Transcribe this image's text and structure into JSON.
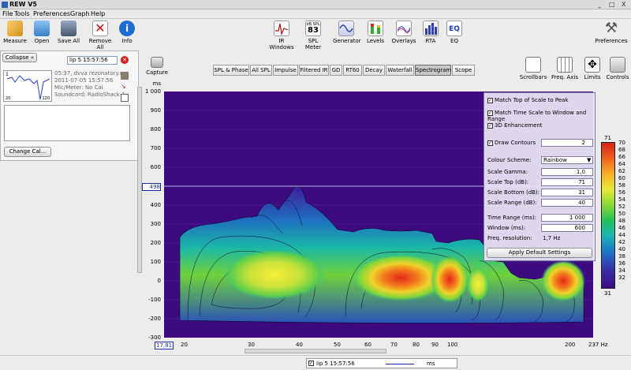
{
  "window": {
    "title": "REW V5",
    "controls": [
      "_",
      "□",
      "X"
    ]
  },
  "menu": [
    "File",
    "Tools",
    "Preferences",
    "Graph",
    "Help"
  ],
  "toolbar_left": [
    {
      "label": "Measure",
      "icon": "measure-icon"
    },
    {
      "label": "Open",
      "icon": "folder-icon"
    },
    {
      "label": "Save All",
      "icon": "save-icon"
    },
    {
      "label": "Remove All",
      "icon": "remove-icon"
    },
    {
      "label": "Info",
      "icon": "info-icon"
    }
  ],
  "toolbar_center": [
    {
      "label": "IR Windows",
      "icon": "ir-windows-icon"
    },
    {
      "label": "SPL Meter",
      "icon": "spl-meter-icon",
      "badge_top": "dB SPL",
      "badge_value": "83"
    },
    {
      "label": "Generator",
      "icon": "generator-icon"
    },
    {
      "label": "Levels",
      "icon": "levels-icon"
    },
    {
      "label": "Overlays",
      "icon": "overlays-icon"
    },
    {
      "label": "RTA",
      "icon": "rta-icon"
    },
    {
      "label": "EQ",
      "icon": "eq-icon"
    }
  ],
  "preferences_label": "Preferences",
  "left_panel": {
    "collapse_label": "Collapse",
    "measurement_name": "lip 5 15:57:56",
    "thumb_labels": [
      "1",
      "20",
      "120"
    ],
    "info_lines": [
      "05:37, dvva rezonatory.mo",
      "2011-07-05 15:57:56",
      "Mic/Meter: No Cal",
      "Soundcard: RadioShack-1"
    ],
    "change_cal_label": "Change Cal..."
  },
  "capture_label": "Capture",
  "tabs": [
    "SPL & Phase",
    "All SPL",
    "Impulse",
    "Filtered IR",
    "GD",
    "RT60",
    "Decay",
    "Waterfall",
    "Spectrogram",
    "Scope"
  ],
  "active_tab": "Spectrogram",
  "right_tools": [
    "Scrollbars",
    "Freq. Axis",
    "Limits",
    "Controls"
  ],
  "y_axis": {
    "unit": "ms",
    "ticks": [
      "1 000",
      "900",
      "800",
      "700",
      "600",
      "500",
      "400",
      "300",
      "200",
      "100",
      "0",
      "-100",
      "-200",
      "-300"
    ],
    "marker": "498",
    "corner": "17,81"
  },
  "x_axis": {
    "ticks": [
      "20",
      "30",
      "40",
      "50",
      "60",
      "70",
      "80",
      "90",
      "100",
      "200"
    ],
    "end_label": "237 Hz"
  },
  "controls": {
    "checks": [
      {
        "label": "Match Top of Scale to Peak",
        "checked": true
      },
      {
        "label": "Match Time Scale to Window and Range",
        "checked": true
      },
      {
        "label": "3D Enhancement",
        "checked": true
      }
    ],
    "draw_contours": {
      "label": "Draw Contours",
      "checked": true,
      "value": "2"
    },
    "colour_scheme": {
      "label": "Colour Scheme:",
      "value": "Rainbow"
    },
    "fields": [
      {
        "label": "Scale Gamma:",
        "value": "1,0"
      },
      {
        "label": "Scale Top (dB):",
        "value": "71"
      },
      {
        "label": "Scale Bottom (dB):",
        "value": "31"
      },
      {
        "label": "Scale Range (dB):",
        "value": "40"
      }
    ],
    "time_fields": [
      {
        "label": "Time Range (ms):",
        "value": "1 000"
      },
      {
        "label": "Window (ms):",
        "value": "600"
      }
    ],
    "freq_resolution": {
      "label": "Freq. resolution:",
      "value": "1,7 Hz"
    },
    "apply_label": "Apply Default Settings"
  },
  "colorbar": {
    "top_label": "71",
    "bottom_label": "31",
    "ticks": [
      "70",
      "68",
      "66",
      "64",
      "62",
      "60",
      "58",
      "56",
      "54",
      "52",
      "50",
      "48",
      "46",
      "44",
      "42",
      "40",
      "38",
      "36",
      "34",
      "32"
    ]
  },
  "legend": {
    "name": "lip 5 15:57:56",
    "unit": "ms",
    "checked": true,
    "line_color": "#1c2fa8"
  },
  "colors": {
    "plot_bg": "#3d0a80",
    "accent": "#2e5fb3"
  }
}
